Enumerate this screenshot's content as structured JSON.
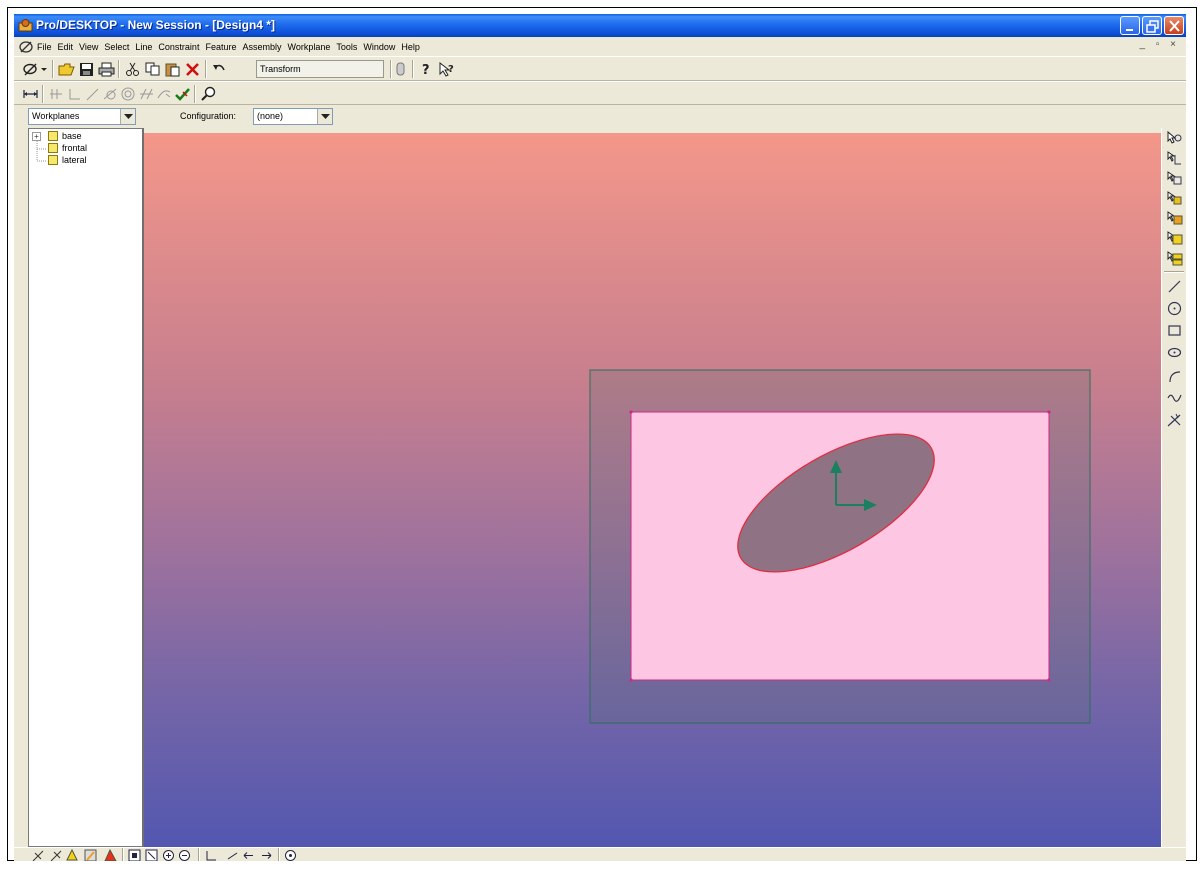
{
  "window": {
    "title": "Pro/DESKTOP - New Session - [Design4 *]",
    "controls": [
      "minimize-icon",
      "restore-icon",
      "close-icon"
    ]
  },
  "menu": {
    "items": [
      "File",
      "Edit",
      "View",
      "Select",
      "Line",
      "Constraint",
      "Feature",
      "Assembly",
      "Workplane",
      "Tools",
      "Window",
      "Help"
    ],
    "mdi_controls": "_ ▫ ×"
  },
  "toolbar": {
    "transform_label": "Transform"
  },
  "combo": {
    "left_value": "Workplanes",
    "config_label": "Configuration:",
    "config_value": "(none)"
  },
  "tree": {
    "expander": "+",
    "items": [
      "base",
      "frontal",
      "lateral"
    ]
  },
  "colors": {
    "viewport_top": "#f4978a",
    "viewport_bottom": "#5357b0",
    "sketch_fill": "#fdc6e2",
    "sketch_border": "#cc2a8a",
    "ellipse_stroke": "#e8263a",
    "workplane_border": "#2c6e5c",
    "axis_arrow": "#1a8060"
  }
}
